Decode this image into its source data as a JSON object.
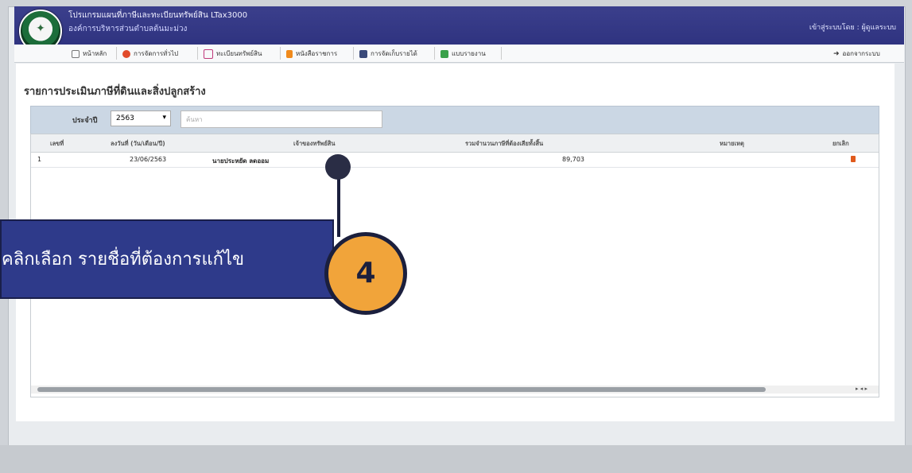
{
  "header": {
    "app_title": "โปรแกรมแผนที่ภาษีและทะเบียนทรัพย์สิน LTax3000",
    "org_name": "องค์การบริหารส่วนตำบลต้นมะม่วง",
    "user_info": "เข้าสู่ระบบโดย : ผู้ดูแลระบบ"
  },
  "menu": {
    "items": [
      {
        "label": "หน้าหลัก",
        "icon": "home-icon"
      },
      {
        "label": "การจัดการทั่วไป",
        "icon": "gears-icon"
      },
      {
        "label": "ทะเบียนทรัพย์สิน",
        "icon": "book-icon"
      },
      {
        "label": "หนังสือราชการ",
        "icon": "document-icon"
      },
      {
        "label": "การจัดเก็บรายได้",
        "icon": "calculator-icon"
      },
      {
        "label": "แบบรายงาน",
        "icon": "table-icon"
      }
    ],
    "logout_label": "ออกจากระบบ"
  },
  "page": {
    "title": "รายการประเมินภาษีที่ดินและสิ่งปลูกสร้าง"
  },
  "filter": {
    "year_label": "ประจำปี",
    "year_value": "2563",
    "search_placeholder": "ค้นหา"
  },
  "table": {
    "columns": [
      "ลงวันที่ (วัน/เดือน/ปี)",
      "เจ้าของทรัพย์สิน",
      "รวมจำนวนภาษีที่ต้องเสียทั้งสิ้น",
      "หมายเหตุ",
      "ยกเลิก"
    ],
    "number_column": "เลขที่",
    "rows": [
      {
        "no": "1",
        "date": "23/06/2563",
        "owner": "นายประหยัด ลดออม",
        "tax_total": "89,703",
        "note": ""
      }
    ]
  },
  "callout": {
    "text": "คลิกเลือก รายชื่อที่ต้องการแก้ไข",
    "step": "4"
  },
  "colors": {
    "header_bg": "#2f3380",
    "callout_bg": "#2e3a8a",
    "step_circle": "#f1a43a",
    "delete_icon": "#e05a1c"
  }
}
